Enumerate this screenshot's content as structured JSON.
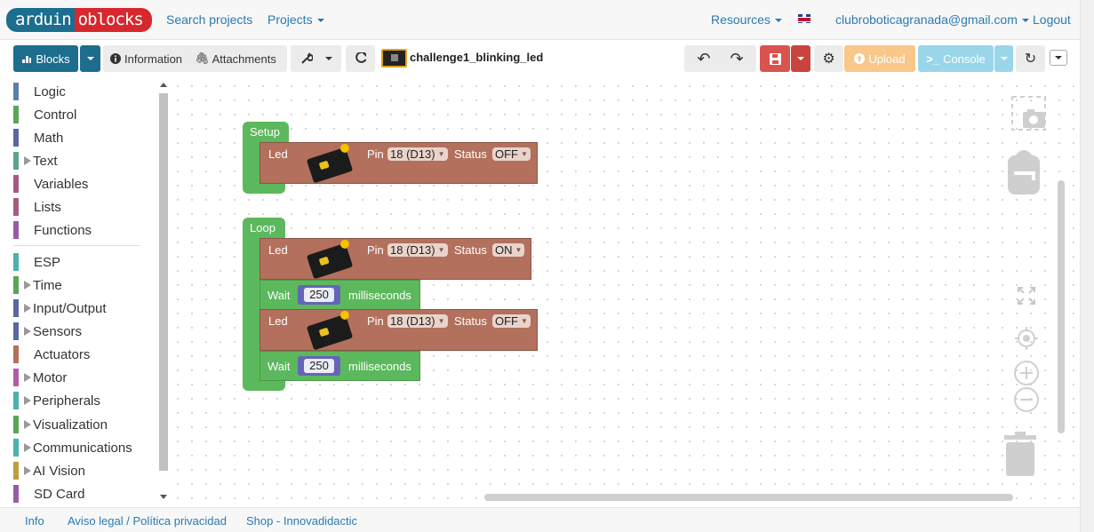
{
  "navbar": {
    "logo_part1": "arduin",
    "logo_part2": "oblocks",
    "search_projects": "Search projects",
    "projects": "Projects",
    "resources": "Resources",
    "account": "clubroboticagranada@gmail.com",
    "logout": "Logout"
  },
  "toolbar": {
    "blocks": "Blocks",
    "information": "Information",
    "attachments": "Attachments",
    "project_name": "challenge1_blinking_led",
    "upload": "Upload",
    "console": "Console"
  },
  "sidebar": {
    "categories": [
      {
        "label": "Logic",
        "color": "#5b80a5",
        "expandable": false
      },
      {
        "label": "Control",
        "color": "#5ba55b",
        "expandable": false
      },
      {
        "label": "Math",
        "color": "#5b67a5",
        "expandable": false
      },
      {
        "label": "Text",
        "color": "#5ba58c",
        "expandable": true
      },
      {
        "label": "Variables",
        "color": "#a55b80",
        "expandable": false
      },
      {
        "label": "Lists",
        "color": "#a55b80",
        "expandable": false
      },
      {
        "label": "Functions",
        "color": "#995ba5",
        "expandable": false
      },
      {
        "label": "ESP",
        "color": "#4fb0b0",
        "expandable": false
      },
      {
        "label": "Time",
        "color": "#5ba55b",
        "expandable": true
      },
      {
        "label": "Input/Output",
        "color": "#5b67a5",
        "expandable": true
      },
      {
        "label": "Sensors",
        "color": "#5b67a5",
        "expandable": true
      },
      {
        "label": "Actuators",
        "color": "#b2705d",
        "expandable": false
      },
      {
        "label": "Motor",
        "color": "#b25da5",
        "expandable": true
      },
      {
        "label": "Peripherals",
        "color": "#4fb0b0",
        "expandable": true
      },
      {
        "label": "Visualization",
        "color": "#5ba55b",
        "expandable": true
      },
      {
        "label": "Communications",
        "color": "#4fb0b0",
        "expandable": true
      },
      {
        "label": "AI Vision",
        "color": "#b8a040",
        "expandable": true
      },
      {
        "label": "SD Card",
        "color": "#995ba5",
        "expandable": false
      }
    ]
  },
  "workspace": {
    "setup_label": "Setup",
    "loop_label": "Loop",
    "setup_led": {
      "label": "Led",
      "pin_label": "Pin",
      "pin": "18 (D13)",
      "status_label": "Status",
      "status": "OFF"
    },
    "loop_led1": {
      "label": "Led",
      "pin_label": "Pin",
      "pin": "18 (D13)",
      "status_label": "Status",
      "status": "ON"
    },
    "wait1": {
      "label": "Wait",
      "value": "250",
      "unit": "milliseconds"
    },
    "loop_led2": {
      "label": "Led",
      "pin_label": "Pin",
      "pin": "18 (D13)",
      "status_label": "Status",
      "status": "OFF"
    },
    "wait2": {
      "label": "Wait",
      "value": "250",
      "unit": "milliseconds"
    }
  },
  "footer": {
    "info": "Info",
    "legal": "Aviso legal / Política privacidad",
    "shop": "Shop - Innovadidactic"
  }
}
